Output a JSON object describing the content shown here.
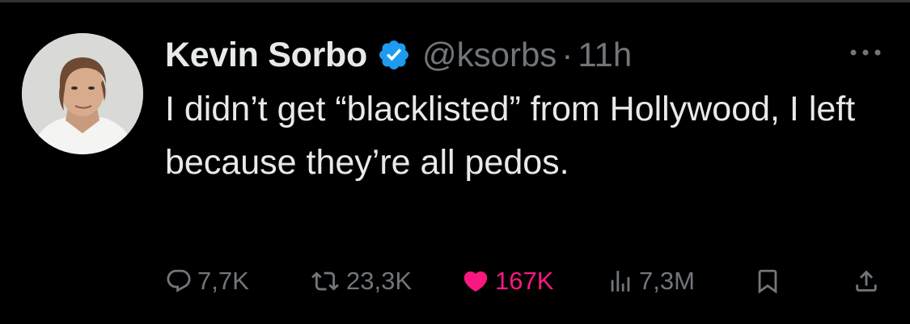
{
  "tweet": {
    "author": {
      "display_name": "Kevin Sorbo",
      "handle": "@ksorbs",
      "verified": true
    },
    "separator": "·",
    "timestamp": "11h",
    "text": "I didn’t get “blacklisted” from Hollywood, I left because they’re all pedos.",
    "metrics": {
      "replies": "7,7K",
      "retweets": "23,3K",
      "likes": "167K",
      "views": "7,3M"
    },
    "liked": true
  },
  "icons": {
    "verified": "verified-badge-icon",
    "more": "more-horizontal-icon",
    "reply": "reply-bubble-icon",
    "retweet": "retweet-icon",
    "like": "heart-icon",
    "views": "bar-chart-icon",
    "bookmark": "bookmark-icon",
    "share": "share-upload-icon"
  },
  "colors": {
    "background": "#000000",
    "text": "#e7e9ea",
    "muted": "#71767b",
    "verified": "#1d9bf0",
    "like": "#f91880"
  }
}
